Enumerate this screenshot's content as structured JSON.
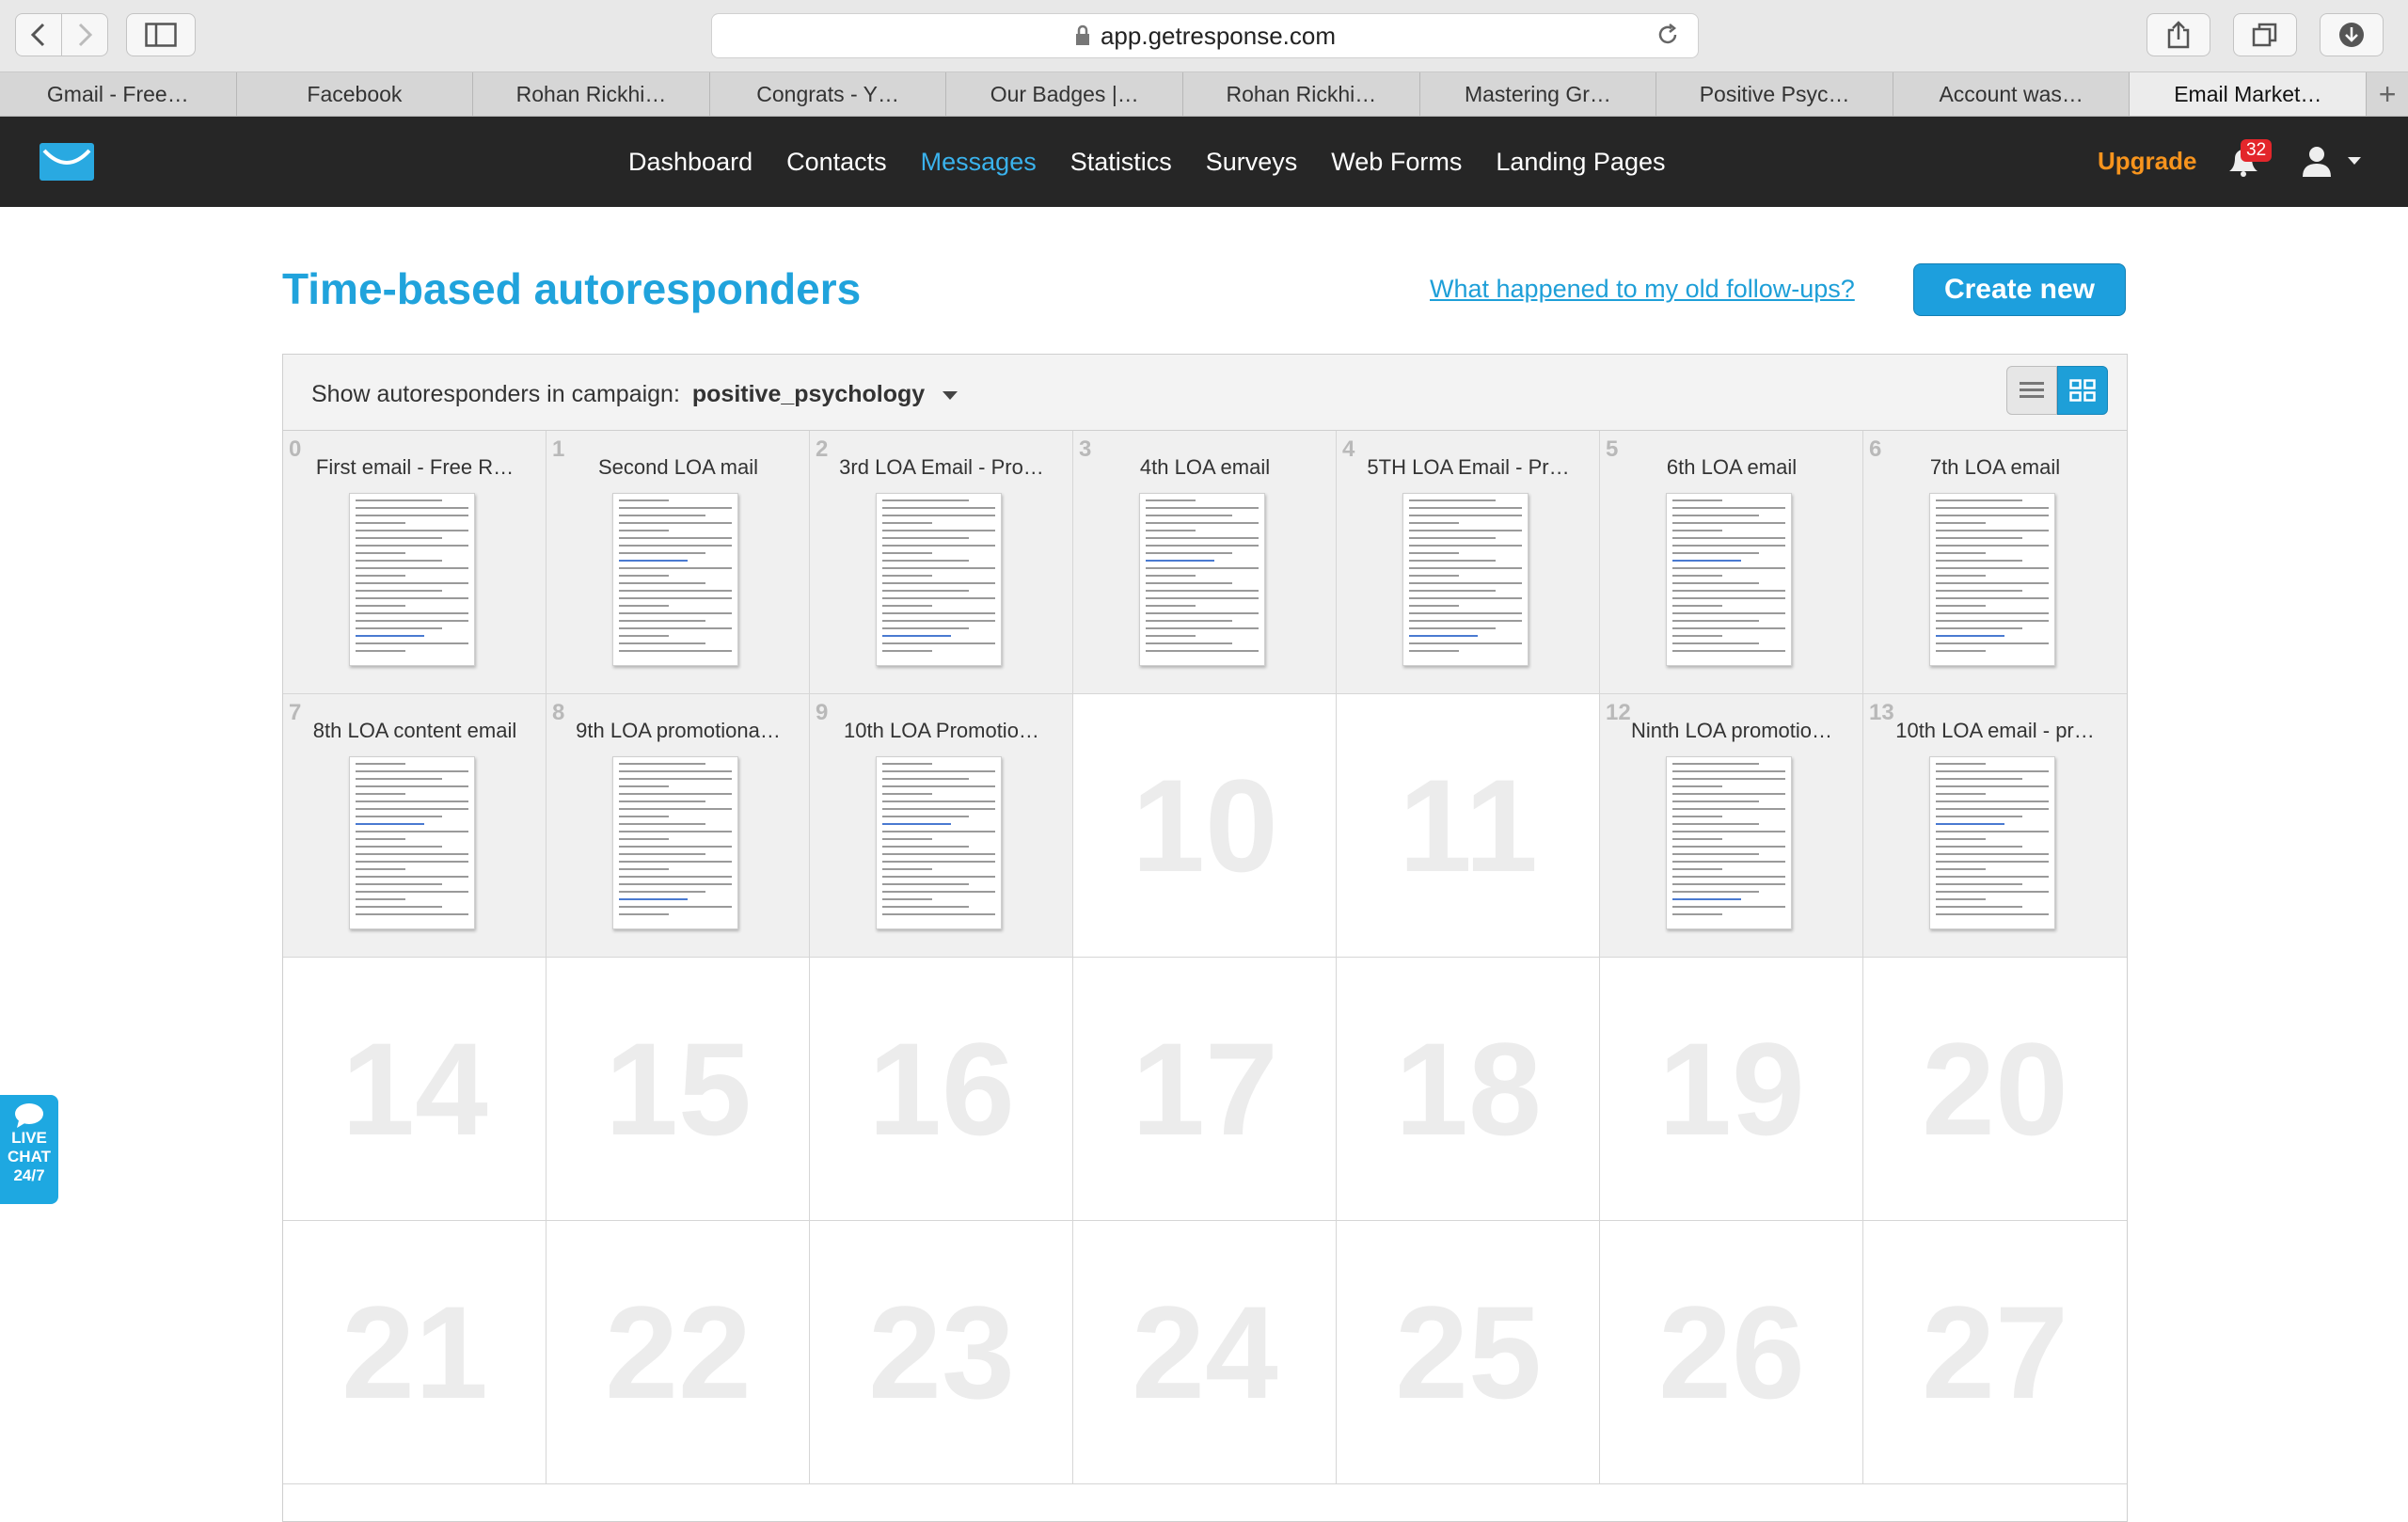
{
  "browser": {
    "url": "app.getresponse.com",
    "tabs": [
      "Gmail - Free…",
      "Facebook",
      "Rohan Rickhi…",
      "Congrats - Y…",
      "Our Badges |…",
      "Rohan Rickhi…",
      "Mastering Gr…",
      "Positive Psyc…",
      "Account was…",
      "Email Market…"
    ],
    "new_tab": "+"
  },
  "header": {
    "nav": [
      "Dashboard",
      "Contacts",
      "Messages",
      "Statistics",
      "Surveys",
      "Web Forms",
      "Landing Pages"
    ],
    "active_nav": "Messages",
    "upgrade": "Upgrade",
    "notification_count": "32"
  },
  "page": {
    "title": "Time-based autoresponders",
    "help_link": "What happened to my old follow-ups?",
    "create_button": "Create new",
    "campaign_label": "Show autoresponders in campaign:",
    "campaign_name": "positive_psychology"
  },
  "calendar": {
    "days": [
      {
        "n": "0",
        "title": "First email - Free R…"
      },
      {
        "n": "1",
        "title": "Second LOA mail"
      },
      {
        "n": "2",
        "title": "3rd LOA Email - Pro…"
      },
      {
        "n": "3",
        "title": "4th LOA email"
      },
      {
        "n": "4",
        "title": "5TH LOA Email - Pr…"
      },
      {
        "n": "5",
        "title": "6th LOA email"
      },
      {
        "n": "6",
        "title": "7th LOA email"
      },
      {
        "n": "7",
        "title": "8th LOA content email"
      },
      {
        "n": "8",
        "title": "9th LOA promotiona…"
      },
      {
        "n": "9",
        "title": "10th LOA Promotio…"
      },
      {
        "n": "10",
        "title": ""
      },
      {
        "n": "11",
        "title": ""
      },
      {
        "n": "12",
        "title": "Ninth LOA promotio…"
      },
      {
        "n": "13",
        "title": "10th LOA email - pr…"
      },
      {
        "n": "14",
        "title": ""
      },
      {
        "n": "15",
        "title": ""
      },
      {
        "n": "16",
        "title": ""
      },
      {
        "n": "17",
        "title": ""
      },
      {
        "n": "18",
        "title": ""
      },
      {
        "n": "19",
        "title": ""
      },
      {
        "n": "20",
        "title": ""
      },
      {
        "n": "21",
        "title": ""
      },
      {
        "n": "22",
        "title": ""
      },
      {
        "n": "23",
        "title": ""
      },
      {
        "n": "24",
        "title": ""
      },
      {
        "n": "25",
        "title": ""
      },
      {
        "n": "26",
        "title": ""
      },
      {
        "n": "27",
        "title": ""
      }
    ]
  },
  "live_chat": [
    "LIVE",
    "CHAT",
    "24/7"
  ],
  "colors": {
    "accent": "#1e9fd8",
    "upgrade": "#f7941d",
    "badge": "#e3262b",
    "header_bg": "#262626"
  },
  "icons": [
    "back-icon",
    "forward-icon",
    "sidebar-icon",
    "lock-icon",
    "reload-icon",
    "share-icon",
    "tabs-icon",
    "download-icon",
    "logo-icon",
    "bell-icon",
    "user-icon",
    "list-view-icon",
    "grid-view-icon",
    "chat-icon"
  ]
}
